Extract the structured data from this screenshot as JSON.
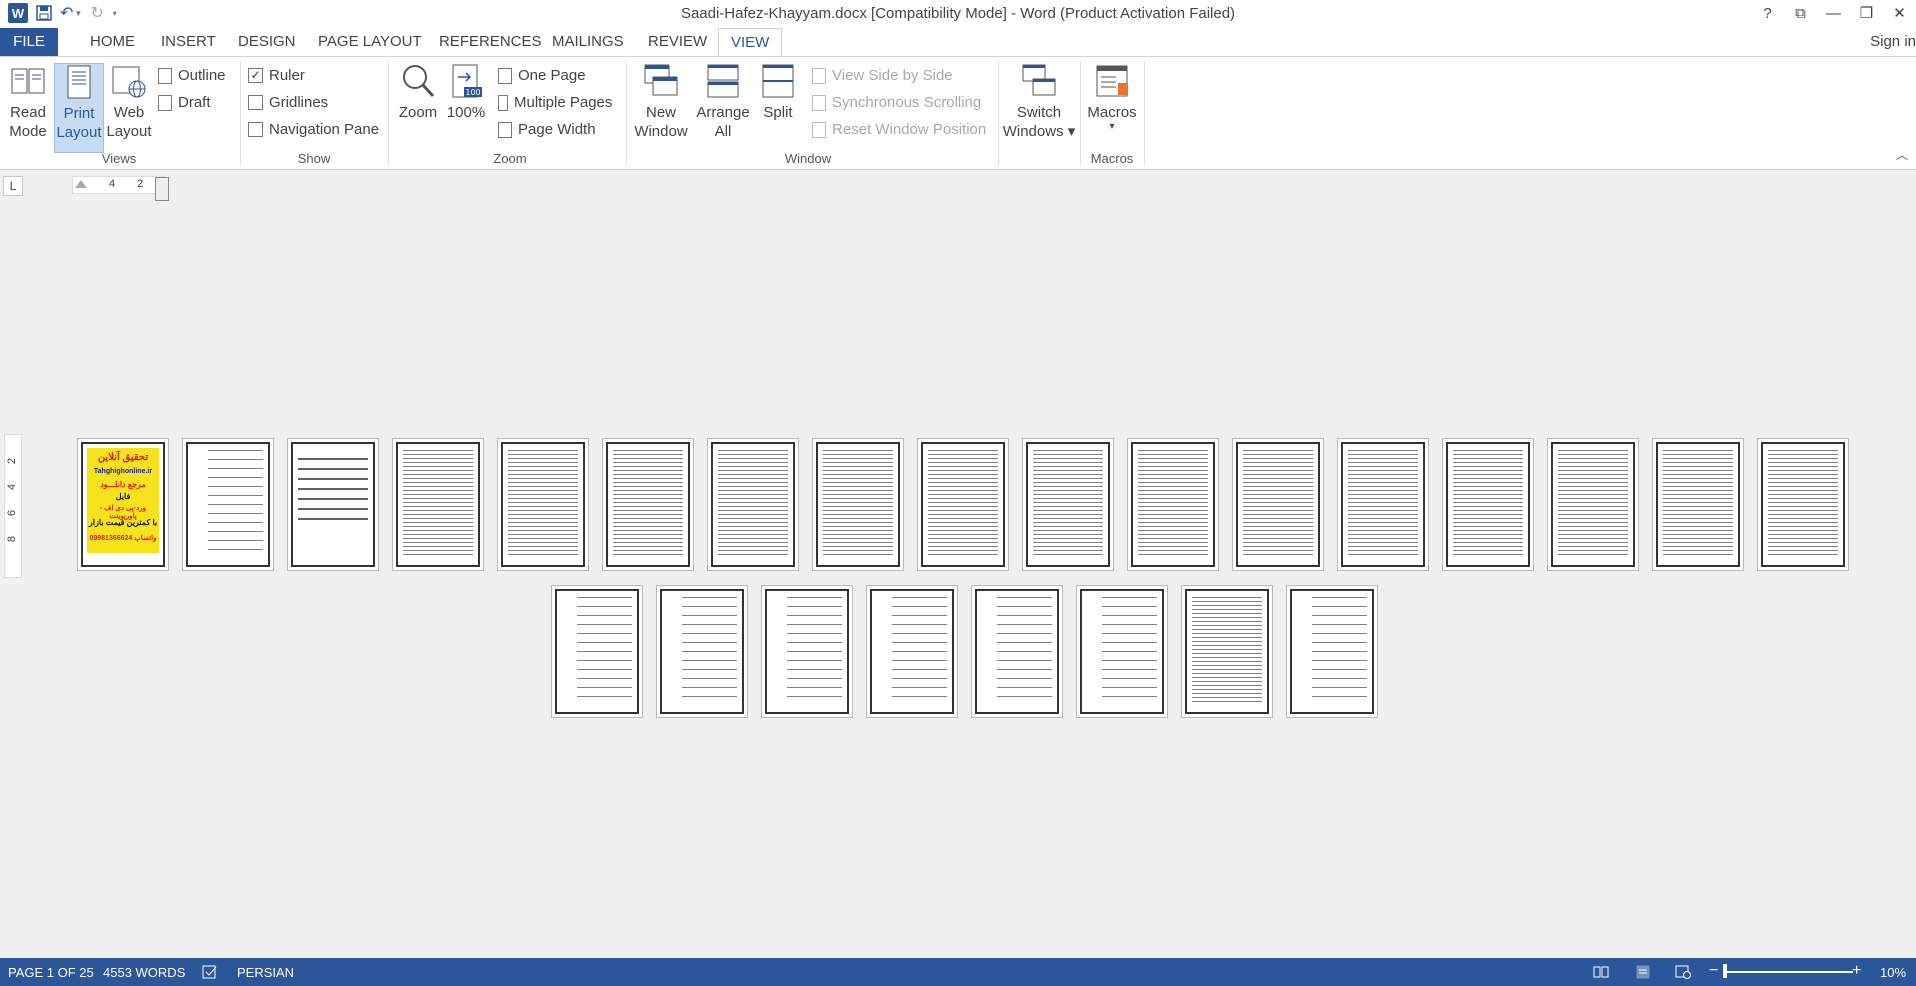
{
  "title_bar": {
    "document_title": "Saadi-Hafez-Khayyam.docx [Compatibility Mode] - Word (Product Activation Failed)",
    "logo_letter": "W",
    "help": "?",
    "ribbon_display": "⧉",
    "minimize": "—",
    "restore": "❐",
    "close": "✕"
  },
  "tabs": [
    "FILE",
    "HOME",
    "INSERT",
    "DESIGN",
    "PAGE LAYOUT",
    "REFERENCES",
    "MAILINGS",
    "REVIEW",
    "VIEW"
  ],
  "active_tab": "VIEW",
  "sign_in": "Sign in",
  "ribbon": {
    "views": {
      "label": "Views",
      "read_mode": [
        "Read",
        "Mode"
      ],
      "print_layout": [
        "Print",
        "Layout"
      ],
      "web_layout": [
        "Web",
        "Layout"
      ],
      "outline": "Outline",
      "draft": "Draft"
    },
    "show": {
      "label": "Show",
      "ruler": "Ruler",
      "gridlines": "Gridlines",
      "navigation_pane": "Navigation Pane",
      "ruler_checked": "✓"
    },
    "zoom": {
      "label": "Zoom",
      "zoom": "Zoom",
      "hundred": "100%",
      "one_page": "One Page",
      "multiple_pages": "Multiple Pages",
      "page_width": "Page Width",
      "icon_badge": "100"
    },
    "window": {
      "label": "Window",
      "new_window": [
        "New",
        "Window"
      ],
      "arrange_all": [
        "Arrange",
        "All"
      ],
      "split": "Split",
      "view_side_by_side": "View Side by Side",
      "synchronous_scrolling": "Synchronous Scrolling",
      "reset_window_position": "Reset Window Position",
      "switch_windows": [
        "Switch",
        "Windows ▾"
      ]
    },
    "macros": {
      "label": "Macros",
      "macros": "Macros",
      "arrow": "▾"
    }
  },
  "ruler": {
    "corner": "L",
    "h_numbers": [
      "4",
      "2"
    ],
    "v_numbers": [
      "2",
      "4",
      "6",
      "8"
    ]
  },
  "cover_page": {
    "line1": "تحقیق آنلاین",
    "line2": "Tahghighonline.ir",
    "line3": "مرجع دانلـــود",
    "line4": "فایل",
    "line5": "ورد-پی دی اف - پاورپوینت",
    "line6": "با کمترین قیمت بازار",
    "line7": "09981366624 واتساپ"
  },
  "status_bar": {
    "page": "PAGE 1 OF 25",
    "words": "4553 WORDS",
    "language": "PERSIAN",
    "zoom_minus": "−",
    "zoom_plus": "+",
    "zoom_level": "10%"
  },
  "colors": {
    "accent": "#2b579a",
    "cover_yellow": "#f7e21c",
    "cover_red": "#d8201c"
  }
}
